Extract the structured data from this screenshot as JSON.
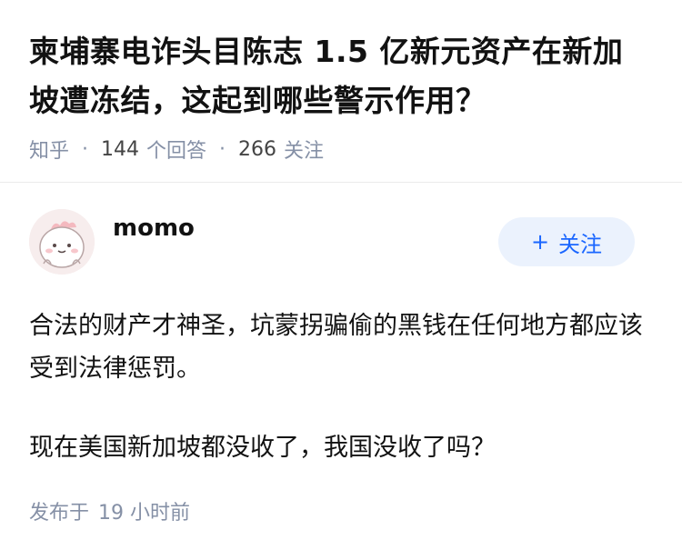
{
  "question": {
    "title": "柬埔寨电诈头目陈志 1.5 亿新元资产在新加坡遭冻结，这起到哪些警示作用？",
    "meta": {
      "source": "知乎",
      "answers_count": "144",
      "answers_label": "个回答",
      "followers_count": "266",
      "followers_label": "关注"
    }
  },
  "answer": {
    "author": {
      "name": "momo",
      "avatar_icon": "cartoon-avatar"
    },
    "follow_button": {
      "icon": "plus-icon",
      "label": "关注"
    },
    "paragraphs": [
      "合法的财产才神圣，坑蒙拐骗偷的黑钱在任何地方都应该受到法律惩罚。",
      "现在美国新加坡都没收了，我国没收了吗？"
    ],
    "published": {
      "label": "发布于",
      "time": "19 小时前"
    }
  },
  "colors": {
    "accent": "#1a66ff",
    "button_bg": "#ebf2fd",
    "meta_gray": "#8590a6"
  }
}
